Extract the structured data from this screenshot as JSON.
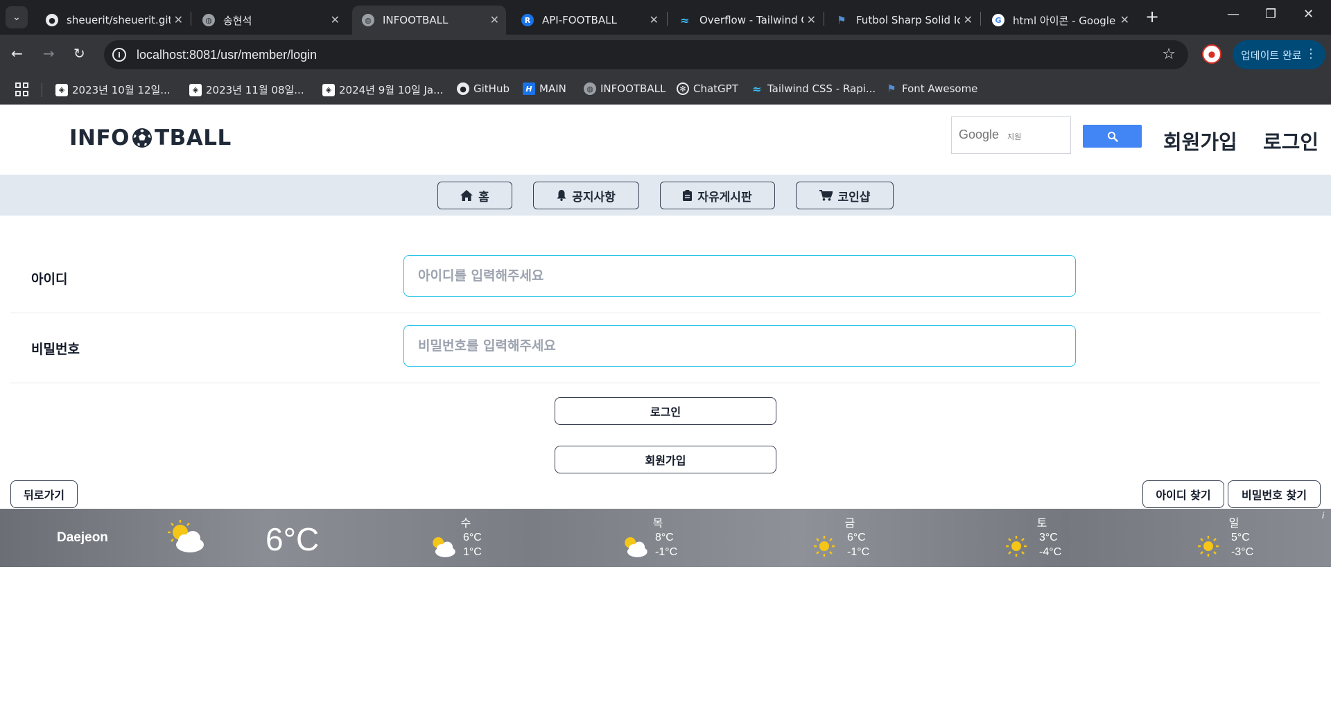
{
  "browser": {
    "tabs": [
      {
        "title": "sheuerit/sheuerit.github",
        "icon": "github-icon",
        "active": false
      },
      {
        "title": "송현석",
        "icon": "globe-icon",
        "active": false
      },
      {
        "title": "INFOOTBALL",
        "icon": "globe-icon",
        "active": true
      },
      {
        "title": "API-FOOTBALL",
        "icon": "api-football-icon",
        "active": false
      },
      {
        "title": "Overflow - Tailwind CSS",
        "icon": "tailwind-icon",
        "active": false
      },
      {
        "title": "Futbol Sharp Solid Icon",
        "icon": "font-awesome-flag-icon",
        "active": false
      },
      {
        "title": "html 아이콘 - Google",
        "icon": "google-icon",
        "active": false
      }
    ],
    "url": "localhost:8081/usr/member/login",
    "update_label": "업데이트 완료",
    "bookmarks": [
      {
        "label": "2023년 10월 12일...",
        "icon": "bookmark-site-icon"
      },
      {
        "label": "2023년 11월 08일...",
        "icon": "bookmark-site-icon"
      },
      {
        "label": "2024년 9월 10일 Ja...",
        "icon": "bookmark-site-icon"
      },
      {
        "label": "GitHub",
        "icon": "github-icon"
      },
      {
        "label": "MAIN",
        "icon": "main-icon"
      },
      {
        "label": "INFOOTBALL",
        "icon": "globe-icon"
      },
      {
        "label": "ChatGPT",
        "icon": "chatgpt-icon"
      },
      {
        "label": "Tailwind CSS - Rapi...",
        "icon": "tailwind-icon"
      },
      {
        "label": "Font Awesome",
        "icon": "font-awesome-flag-icon"
      }
    ]
  },
  "site": {
    "logo_left": "INFO",
    "logo_right": "TBALL",
    "google_label": "Google",
    "google_sub": "지원",
    "signup_link": "회원가입",
    "login_link": "로그인"
  },
  "nav": [
    {
      "label": "홈",
      "icon": "home-icon"
    },
    {
      "label": "공지사항",
      "icon": "bell-icon"
    },
    {
      "label": "자유게시판",
      "icon": "clipboard-icon"
    },
    {
      "label": "코인샵",
      "icon": "cart-icon"
    }
  ],
  "form": {
    "id_label": "아이디",
    "id_placeholder": "아이디를 입력해주세요",
    "pw_label": "비밀번호",
    "pw_placeholder": "비밀번호를 입력해주세요",
    "login_button": "로그인",
    "signup_button": "회원가입",
    "back_button": "뒤로가기",
    "find_id_button": "아이디 찾기",
    "find_pw_button": "비밀번호 찾기"
  },
  "weather": {
    "city": "Daejeon",
    "current_temp": "6°C",
    "current_icon": "partly-cloudy-icon",
    "info": "i",
    "days": [
      {
        "name": "수",
        "hi": "6°C",
        "lo": "1°C",
        "icon": "partly-cloudy-icon"
      },
      {
        "name": "목",
        "hi": "8°C",
        "lo": "-1°C",
        "icon": "partly-cloudy-icon"
      },
      {
        "name": "금",
        "hi": "6°C",
        "lo": "-1°C",
        "icon": "sun-icon"
      },
      {
        "name": "토",
        "hi": "3°C",
        "lo": "-4°C",
        "icon": "sun-icon"
      },
      {
        "name": "일",
        "hi": "5°C",
        "lo": "-3°C",
        "icon": "sun-icon"
      }
    ]
  },
  "colors": {
    "input_border": "#22c3e6",
    "nav_strip": "#e2e8f0",
    "search_button": "#4285f4"
  }
}
